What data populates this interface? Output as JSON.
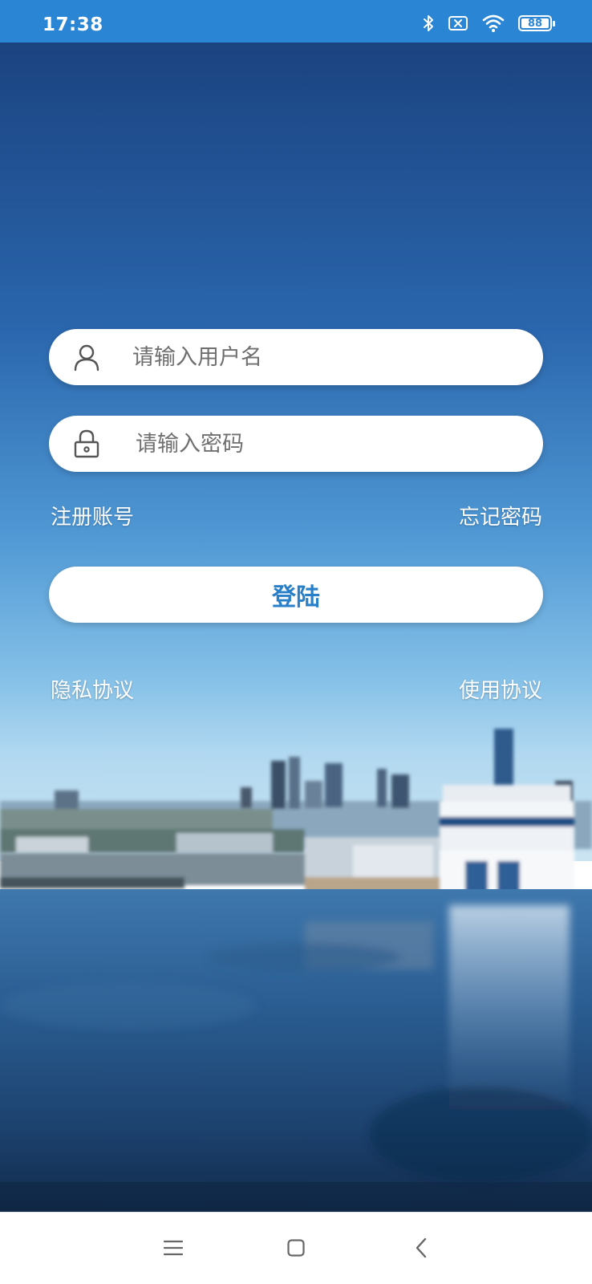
{
  "status_bar": {
    "time": "17:38",
    "battery_level": "88",
    "icons": [
      "bluetooth-icon",
      "no-sim-icon",
      "wifi-icon",
      "battery-icon"
    ]
  },
  "login_form": {
    "username": {
      "placeholder": "请输入用户名",
      "value": "",
      "icon": "user-icon"
    },
    "password": {
      "placeholder": "请输入密码",
      "value": "",
      "icon": "lock-icon"
    },
    "register_label": "注册账号",
    "forgot_label": "忘记密码",
    "login_label": "登陆",
    "privacy_label": "隐私协议",
    "terms_label": "使用协议"
  },
  "nav_bar": {
    "icons": [
      "menu-icon",
      "home-icon",
      "back-icon"
    ]
  },
  "colors": {
    "status_bar": "#2a86d4",
    "login_text": "#2a7fc9",
    "sky_top": "#1b4683",
    "sky_horizon": "#a9d4ef",
    "water": "#1c3d66"
  }
}
